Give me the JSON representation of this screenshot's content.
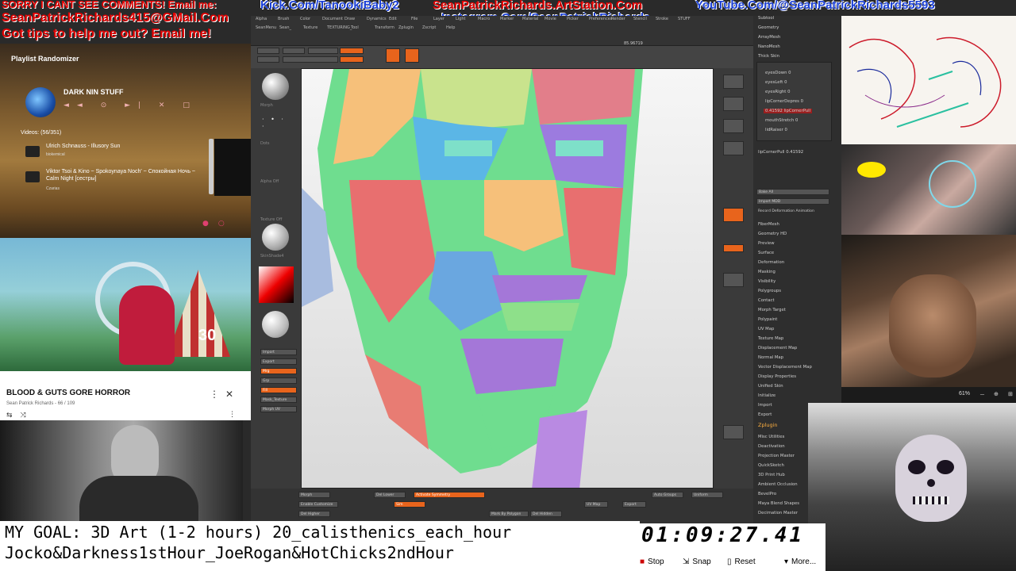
{
  "banner": {
    "line1_red": "SORRY I CANT SEE COMMENTS! Email me:",
    "line1_blue": "Kick.Com/TanookiBaby2",
    "line1_red2": "SeanPatrickRichards.ArtStation.Com",
    "line1_blue2": "YouTube.Com/@SeanPatrickRichards5593",
    "line2_red": "SeanPatrickRichards415@GMail.Com",
    "line3_red": "Got tips to help me out? Email me!",
    "line3_blue": "Instagram.Com/SeanPatrickRichards"
  },
  "playlist": {
    "title": "Playlist Randomizer",
    "name": "DARK NIN STUFF",
    "controls": "◄◄ ⊙ ►| ✕ □",
    "videos_count": "Videos: (56/351)",
    "videos": [
      {
        "title": "Ulrich Schnauss - Illusory Sun",
        "artist": "biokemical"
      },
      {
        "title": "Viktor Tsoi & Kino ~ Spokoynaya Noch' ~ Спокойная Ночь ~ Calm Night [сестры]",
        "artist": "Czarias"
      }
    ]
  },
  "anime": {
    "overlay_number": "30"
  },
  "gore_playlist": {
    "title": "BLOOD & GUTS GORE HORROR",
    "subtitle": "Sean Patrick Richards - 66 / 109",
    "menu_icon": "⋮",
    "close_icon": "✕",
    "loop_icon": "⇆",
    "shuffle_icon": "⤨"
  },
  "captions": {
    "line1": "MY GOAL: 3D Art (1-2 hours) 20_calisthenics_each_hour",
    "line2": "Jocko&Darkness1stHour_JoeRogan&HotChicks2ndHour"
  },
  "timer": {
    "value": "01:09:27.41",
    "stop": "Stop",
    "snap": "Snap",
    "reset": "Reset",
    "more": "More..."
  },
  "zbrush": {
    "menu_tabs": [
      "Alpha",
      "Brush",
      "Color",
      "Document",
      "Draw",
      "Dynamics",
      "Edit",
      "File",
      "Layer",
      "Light",
      "Macro",
      "Marker",
      "Material",
      "Movie",
      "Picker",
      "Preferences",
      "Render",
      "Stencil",
      "Stroke",
      "STUFF"
    ],
    "menu_tabs2": [
      "SeanMenu",
      "Sean_",
      "Texture",
      "TEXTURING_",
      "Tool",
      "Transform",
      "Zplugin",
      "Zscript",
      "Help"
    ],
    "shelf_value": "85.96719",
    "left_labels": [
      "Morph",
      "Dots",
      "Alpha Off",
      "Texture Off",
      "SkinShade4"
    ],
    "left_buttons": [
      "Import",
      "Export",
      "Mrg",
      "Grp",
      "Fill",
      "Mask_Texture",
      "Morph UV"
    ],
    "morph_panel": [
      {
        "label": "eyesDown",
        "value": "0"
      },
      {
        "label": "eyesLeft",
        "value": "0"
      },
      {
        "label": "eyesRight",
        "value": "0"
      },
      {
        "label": "lipCornerDepres",
        "value": "0"
      },
      {
        "label": "0.41592  lipCornerPull",
        "value": ""
      },
      {
        "label": "mouthStretch",
        "value": "0"
      },
      {
        "label": "lidRaiser",
        "value": "0"
      }
    ],
    "morph_selected": "lipCornerPull 0.41592",
    "panel_top": [
      "Subtool",
      "Geometry",
      "ArrayMesh",
      "NanoMesh",
      "Thick Skin"
    ],
    "panel_btns": [
      "Bake All",
      "Import MDD",
      "Record Deformation Animation"
    ],
    "panel_items": [
      "FiberMesh",
      "Geometry HD",
      "Preview",
      "Surface",
      "Deformation",
      "Masking",
      "Visibility",
      "Polygroups",
      "Contact",
      "Morph Target",
      "Polypaint",
      "UV Map",
      "Texture Map",
      "Displacement Map",
      "Normal Map",
      "Vector Displacement Map",
      "Display Properties",
      "Unified Skin",
      "Initialize",
      "Import",
      "Export"
    ],
    "zplugin_header": "Zplugin",
    "zplugin_items": [
      "Misc Utilities",
      "Deactivation",
      "Projection Master",
      "QuickSketch",
      "3D Print Hub",
      "Ambient Occlusion",
      "BevelPro",
      "Maya Blend Shapes",
      "Decimation Master"
    ],
    "bottom_labels": [
      "Morph",
      "Enable Customize",
      "Del Higher",
      "Del Lower",
      "Activate Symmetry",
      "Sim",
      "Mark By Polygon",
      "Del Hidden",
      "Auto Groups",
      "Uniform",
      "UV Map",
      "Export"
    ]
  },
  "viewer": {
    "zoom": "61%"
  },
  "colors": {
    "accent": "#e8641c",
    "banner_red": "#e00000",
    "banner_blue": "#1a3fd6"
  }
}
